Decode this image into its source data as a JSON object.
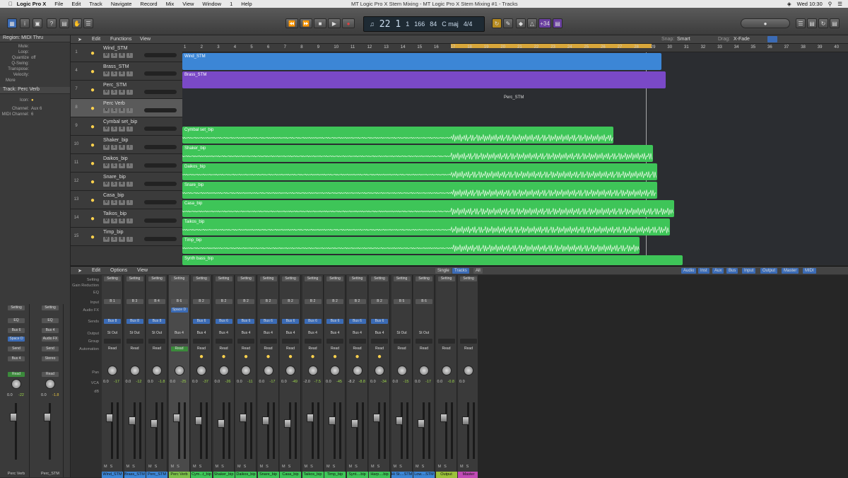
{
  "menubar": {
    "app": "Logic Pro X",
    "items": [
      "File",
      "Edit",
      "Track",
      "Navigate",
      "Record",
      "Mix",
      "View",
      "Window",
      "1",
      "Help"
    ],
    "window_title": "MT Logic Pro X Stem Mixing - MT Logic Pro X Stem Mixing #1 - Tracks",
    "clock": "Wed 10:30"
  },
  "lcd": {
    "bar": "22",
    "beat": "1",
    "div": "1",
    "tick": "166",
    "tempo": "84",
    "key": "C maj",
    "sig": "4/4"
  },
  "cpu_badge": "+34",
  "inspector": {
    "region_header": "Region: MIDI Thru",
    "rows": [
      {
        "k": "Mute:",
        "v": ""
      },
      {
        "k": "Loop:",
        "v": ""
      },
      {
        "k": "Quantize",
        "v": "off"
      },
      {
        "k": "Q-Swing:",
        "v": ""
      },
      {
        "k": "Transpose:",
        "v": ""
      },
      {
        "k": "Velocity:",
        "v": ""
      }
    ],
    "more": "More",
    "track_header": "Track: Perc Verb",
    "icon_label": "Icon:",
    "channel_label": "Channel:",
    "channel_value": "Aux 6",
    "midi_label": "MIDI Channel:",
    "midi_value": "6",
    "strip1": {
      "setting": "Setting",
      "eq": "EQ",
      "input": "Bus 6",
      "fx": "Space D",
      "send": "Send",
      "output": "Bus 4",
      "auto": "Read",
      "v1": "0.0",
      "v2": "-22",
      "name": "Perc Verb"
    },
    "strip2": {
      "setting": "Setting",
      "eq": "EQ",
      "input": "Bus 4",
      "fx": "Audio FX",
      "send": "Send",
      "output": "Stereo Out",
      "auto": "Read",
      "v1": "0.0",
      "v2": "-1.8",
      "name": "Perc_STM"
    }
  },
  "trackarea_header": {
    "edit": "Edit",
    "functions": "Functions",
    "view": "View",
    "snap_label": "Snap:",
    "snap_value": "Smart",
    "drag_label": "Drag:",
    "drag_value": "X-Fade"
  },
  "ruler": [
    "1",
    "2",
    "3",
    "4",
    "5",
    "6",
    "7",
    "8",
    "9",
    "10",
    "11",
    "12",
    "13",
    "14",
    "15",
    "16",
    "17",
    "18",
    "19",
    "20",
    "21",
    "22",
    "23",
    "24",
    "25",
    "26",
    "27",
    "28",
    "29",
    "30",
    "31",
    "32",
    "33",
    "34",
    "35",
    "36",
    "37",
    "38",
    "39",
    "40"
  ],
  "tracks": [
    {
      "num": "1",
      "name": "Wind_STM",
      "icon": "folder-icon"
    },
    {
      "num": "4",
      "name": "Brass_STM",
      "icon": "folder-icon"
    },
    {
      "num": "7",
      "name": "Perc_STM",
      "icon": "folder-icon"
    },
    {
      "num": "8",
      "name": "Perc Verb",
      "icon": "aux-icon"
    },
    {
      "num": "9",
      "name": "Cymbal set_bip",
      "icon": "cymbal-icon"
    },
    {
      "num": "10",
      "name": "Shaker_bip",
      "icon": "shaker-icon"
    },
    {
      "num": "11",
      "name": "Daikos_bip",
      "icon": "drum-icon"
    },
    {
      "num": "12",
      "name": "Snare_bip",
      "icon": "snare-icon"
    },
    {
      "num": "13",
      "name": "Casa_bip",
      "icon": "cabasa-icon"
    },
    {
      "num": "14",
      "name": "Taikos_bip",
      "icon": "taiko-icon"
    },
    {
      "num": "15",
      "name": "Timp_bip",
      "icon": "timpani-icon"
    }
  ],
  "regions": [
    {
      "name": "Wind_STM",
      "color": "blue",
      "start": 0,
      "end": 678
    },
    {
      "name": "Brass_STM",
      "color": "purple",
      "start": 0,
      "end": 684
    },
    {
      "name": "Perc_STM",
      "color": "none",
      "start": 0,
      "end": 0
    },
    {
      "name": "",
      "color": "none",
      "start": 0,
      "end": 0
    },
    {
      "name": "Cymbal set_bip",
      "color": "green",
      "start": 0,
      "end": 610
    },
    {
      "name": "Shaker_bip",
      "color": "green",
      "start": 0,
      "end": 666
    },
    {
      "name": "Daikos_bip",
      "color": "green",
      "start": 0,
      "end": 672
    },
    {
      "name": "Snare_bip",
      "color": "green",
      "start": 0,
      "end": 672
    },
    {
      "name": "Casa_bip",
      "color": "green",
      "start": 0,
      "end": 696
    },
    {
      "name": "Taikos_bip",
      "color": "green",
      "start": 0,
      "end": 690
    },
    {
      "name": "Timp_bip",
      "color": "green",
      "start": 0,
      "end": 647
    }
  ],
  "last_region": "Synth bass_bip",
  "mixer": {
    "edit": "Edit",
    "options": "Options",
    "view": "View",
    "tabs": [
      "Single",
      "Tracks",
      "All"
    ],
    "filters": [
      "Audio",
      "Inst",
      "Aux",
      "Bus",
      "Input",
      "Output",
      "Master",
      "MIDI"
    ],
    "row_labels": [
      "Setting",
      "Gain Reduction",
      "EQ",
      "Input",
      "Audio FX",
      "Sends",
      "Output",
      "Group",
      "Automation",
      "Pan",
      "VCA",
      "dB"
    ],
    "strips": [
      {
        "input": "B 1",
        "fx": "",
        "send": "Bus 8",
        "output": "St Out",
        "auto": "Read",
        "v1": "0.0",
        "v2": "-17",
        "name": "Wind_STM",
        "color": "#3c86d6",
        "icon": ""
      },
      {
        "input": "B 3",
        "fx": "",
        "send": "Bus 8",
        "output": "St Out",
        "auto": "Read",
        "v1": "0.0",
        "v2": "-12",
        "name": "Brass_STM",
        "color": "#3c86d6",
        "icon": ""
      },
      {
        "input": "B 4",
        "fx": "",
        "send": "Bus 8",
        "output": "St Out",
        "auto": "Read",
        "v1": "0.0",
        "v2": "-1.8",
        "name": "Perc_STM",
        "color": "#3c86d6",
        "icon": ""
      },
      {
        "input": "B 6",
        "fx": "Space D",
        "send": "",
        "output": "Bus 4",
        "auto": "Read",
        "v1": "0.0",
        "v2": "-25",
        "name": "Perc Verb",
        "color": "#7dc04a",
        "icon": ""
      },
      {
        "input": "B 2",
        "fx": "",
        "send": "Bus 6",
        "output": "Bus 4",
        "auto": "Read",
        "v1": "0.0",
        "v2": "-37",
        "name": "Cym...t_bip",
        "color": "#3ec558",
        "icon": "cymbal-icon"
      },
      {
        "input": "B 2",
        "fx": "",
        "send": "Bus 6",
        "output": "Bus 4",
        "auto": "Read",
        "v1": "0.0",
        "v2": "-26",
        "name": "Shaker_bip",
        "color": "#3ec558",
        "icon": "shaker-icon"
      },
      {
        "input": "B 2",
        "fx": "",
        "send": "Bus 6",
        "output": "Bus 4",
        "auto": "Read",
        "v1": "0.0",
        "v2": "-11",
        "name": "Daikos_bip",
        "color": "#3ec558",
        "icon": "drum-icon"
      },
      {
        "input": "B 2",
        "fx": "",
        "send": "Bus 6",
        "output": "Bus 4",
        "auto": "Read",
        "v1": "0.0",
        "v2": "-17",
        "name": "Snare_bip",
        "color": "#3ec558",
        "icon": "snare-icon"
      },
      {
        "input": "B 2",
        "fx": "",
        "send": "Bus 6",
        "output": "Bus 4",
        "auto": "Read",
        "v1": "0.0",
        "v2": "-49",
        "name": "Casa_bip",
        "color": "#3ec558",
        "icon": "cabasa-icon"
      },
      {
        "input": "B 2",
        "fx": "",
        "send": "Bus 6",
        "output": "Bus 4",
        "auto": "Read",
        "v1": "-2.0",
        "v2": "-7.5",
        "name": "Taikos_bip",
        "color": "#3ec558",
        "icon": "taiko-icon"
      },
      {
        "input": "B 2",
        "fx": "",
        "send": "Bus 6",
        "output": "Bus 4",
        "auto": "Read",
        "v1": "0.0",
        "v2": "-45",
        "name": "Timp_bip",
        "color": "#3ec558",
        "icon": "timpani-icon"
      },
      {
        "input": "B 2",
        "fx": "",
        "send": "Bus 6",
        "output": "Bus 4",
        "auto": "Read",
        "v1": "-8.2",
        "v2": "-8.8",
        "name": "Synt....bip",
        "color": "#3ec558",
        "icon": "synth-icon"
      },
      {
        "input": "B 2",
        "fx": "",
        "send": "Bus 6",
        "output": "Bus 4",
        "auto": "Read",
        "v1": "0.0",
        "v2": "-34",
        "name": "Harp....bip",
        "color": "#3ec558",
        "icon": "harp-icon"
      },
      {
        "input": "B 5",
        "fx": "",
        "send": "",
        "output": "St Out",
        "auto": "Read",
        "v1": "0.0",
        "v2": "-15",
        "name": "Hi St....STM",
        "color": "#3c86d6",
        "icon": ""
      },
      {
        "input": "B 6",
        "fx": "",
        "send": "",
        "output": "St Out",
        "auto": "Read",
        "v1": "0.0",
        "v2": "-17",
        "name": "Low....STM",
        "color": "#3c86d6",
        "icon": ""
      },
      {
        "input": "",
        "fx": "",
        "send": "",
        "output": "",
        "auto": "Read",
        "v1": "0.0",
        "v2": "-0.8",
        "name": "Output",
        "color": "#9bc23a",
        "icon": ""
      },
      {
        "input": "",
        "fx": "",
        "send": "",
        "output": "",
        "auto": "Read",
        "v1": "0.0",
        "v2": "",
        "name": "Master",
        "color": "#c04ab5",
        "icon": ""
      }
    ]
  }
}
